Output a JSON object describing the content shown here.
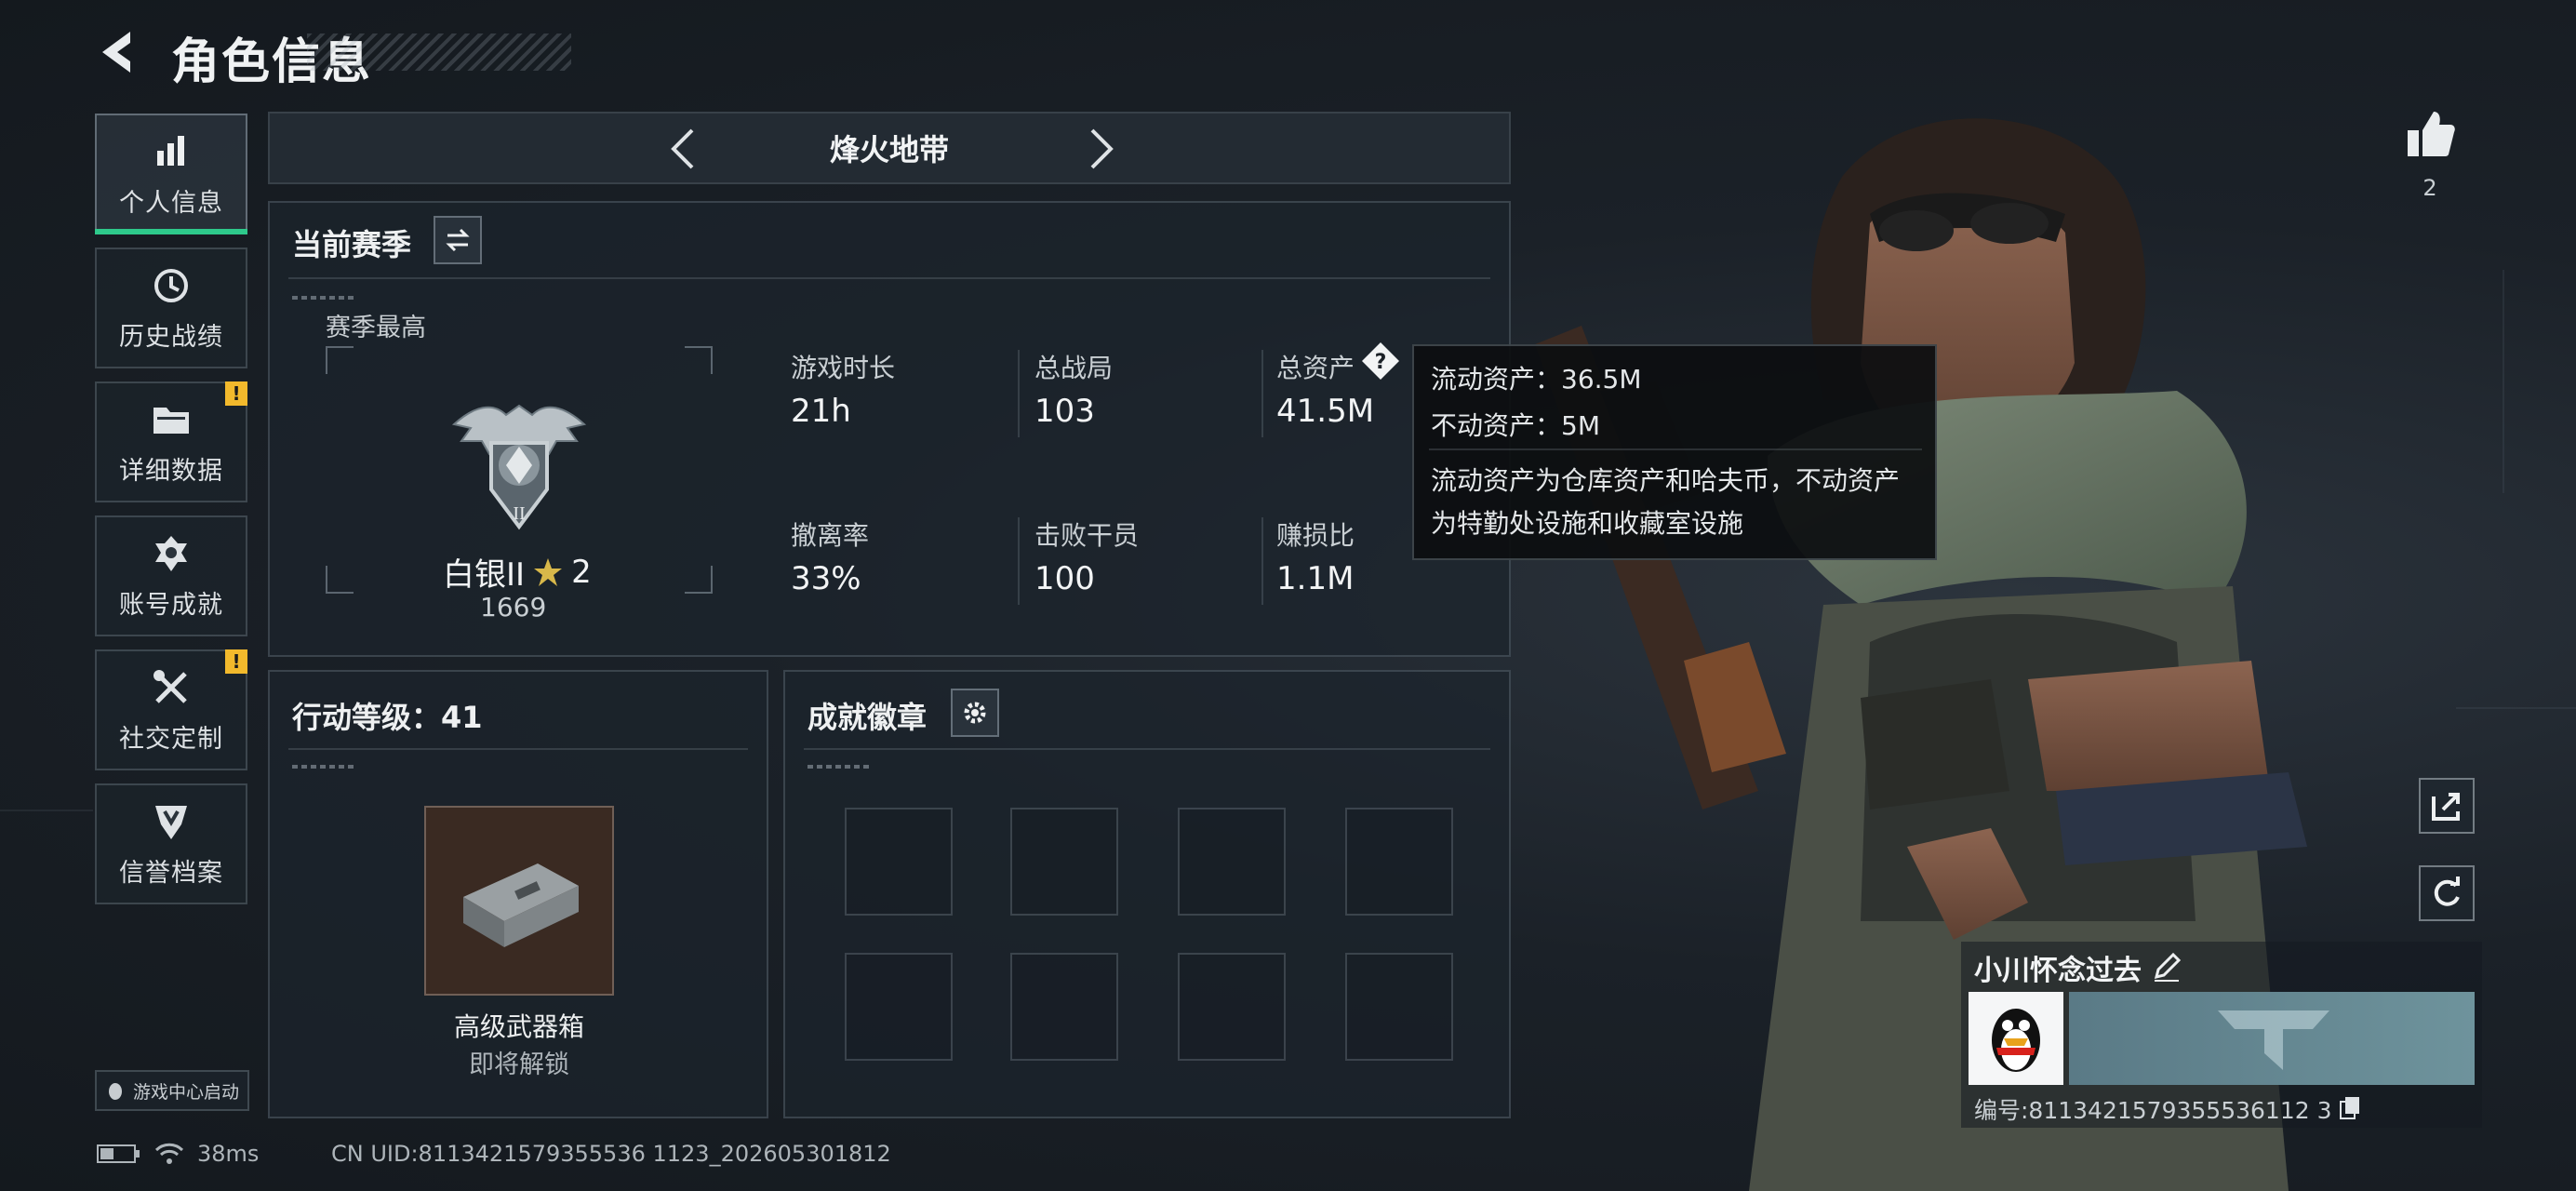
{
  "header": {
    "title": "角色信息",
    "back_icon": "back-arrow-icon"
  },
  "sidebar": {
    "items": [
      {
        "label": "个人信息",
        "icon": "bar-chart-icon",
        "active": true,
        "warning": false
      },
      {
        "label": "历史战绩",
        "icon": "history-clock-icon",
        "active": false,
        "warning": false
      },
      {
        "label": "详细数据",
        "icon": "folder-icon",
        "active": false,
        "warning": true
      },
      {
        "label": "账号成就",
        "icon": "medal-icon",
        "active": false,
        "warning": false
      },
      {
        "label": "社交定制",
        "icon": "tools-icon",
        "active": false,
        "warning": true
      },
      {
        "label": "信誉档案",
        "icon": "shield-emblem-icon",
        "active": false,
        "warning": false
      }
    ],
    "warning_mark": "!",
    "game_center_label": "游戏中心启动"
  },
  "mode_selector": {
    "title": "烽火地带"
  },
  "season": {
    "title": "当前赛季",
    "best_label": "赛季最高",
    "rank_name": "白银II",
    "rank_stars": "2",
    "rank_score": "1669",
    "rank_emblem_numeral": "II",
    "stats": [
      {
        "label": "游戏时长",
        "value": "21h"
      },
      {
        "label": "总战局",
        "value": "103"
      },
      {
        "label": "总资产",
        "value": "41.5M"
      },
      {
        "label": "撤离率",
        "value": "33%"
      },
      {
        "label": "击败干员",
        "value": "100"
      },
      {
        "label": "赚损比",
        "value": "1.1M"
      }
    ]
  },
  "tooltip": {
    "liquid": "流动资产：36.5M",
    "fixed": "不动资产：5M",
    "description": "流动资产为仓库资产和哈夫币，不动资产为特勤处设施和收藏室设施"
  },
  "action_level": {
    "title": "行动等级：41",
    "reward_name": "高级武器箱",
    "reward_status": "即将解锁"
  },
  "achievements": {
    "title": "成就徽章",
    "slot_count": 8
  },
  "likes": {
    "count": "2"
  },
  "player_card": {
    "name": "小川怀念过去",
    "id_text": "编号:8113421579355536112 3"
  },
  "status_bar": {
    "ping": "38ms",
    "uid": "CN UID:8113421579355536 1123_202605301812"
  },
  "colors": {
    "accent_green": "#2ec98b",
    "warning_yellow": "#f2b92c"
  }
}
